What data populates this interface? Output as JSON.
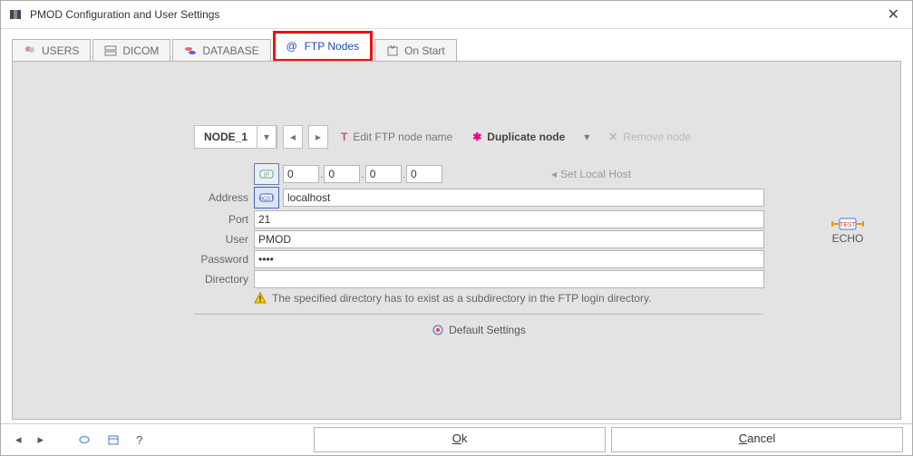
{
  "window": {
    "title": "PMOD Configuration and User Settings"
  },
  "tabs": {
    "users": "USERS",
    "dicom": "DICOM",
    "database": "DATABASE",
    "ftp": "FTP Nodes",
    "onstart": "On Start"
  },
  "nodebar": {
    "selected": "NODE_1",
    "edit": "Edit FTP node name",
    "duplicate": "Duplicate node",
    "remove": "Remove node"
  },
  "form": {
    "labels": {
      "address": "Address",
      "port": "Port",
      "user": "User",
      "password": "Password",
      "directory": "Directory"
    },
    "ip": {
      "a": "0",
      "b": "0",
      "c": "0",
      "d": "0"
    },
    "setlocal": "Set Local Host",
    "host": "localhost",
    "port": "21",
    "user": "PMOD",
    "password": "••••",
    "directory": "",
    "hint": "The specified directory has to exist as a subdirectory in the FTP login directory."
  },
  "echo": "ECHO",
  "default_settings": "Default Settings",
  "buttons": {
    "ok": "Ok",
    "cancel": "Cancel"
  }
}
